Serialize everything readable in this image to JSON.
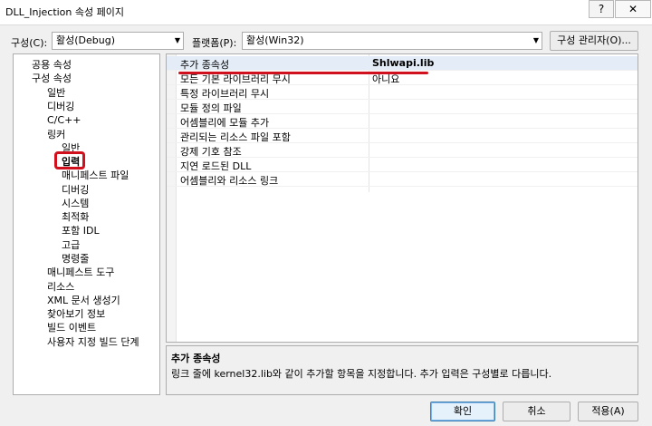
{
  "window": {
    "title": "DLL_Injection 속성 페이지",
    "help_label": "?",
    "close_label": "✕"
  },
  "toolbar": {
    "config_label": "구성(C):",
    "config_value": "활성(Debug)",
    "platform_label": "플랫폼(P):",
    "platform_value": "활성(Win32)",
    "config_manager_label": "구성 관리자(O)..."
  },
  "tree": {
    "items": [
      {
        "label": "공용 속성"
      },
      {
        "label": "구성 속성"
      },
      {
        "label": "일반"
      },
      {
        "label": "디버깅"
      },
      {
        "label": "C/C++"
      },
      {
        "label": "링커"
      },
      {
        "label": "일반"
      },
      {
        "label": "입력",
        "selected": true
      },
      {
        "label": "매니페스트 파일"
      },
      {
        "label": "디버깅"
      },
      {
        "label": "시스템"
      },
      {
        "label": "최적화"
      },
      {
        "label": "포함 IDL"
      },
      {
        "label": "고급"
      },
      {
        "label": "명령줄"
      },
      {
        "label": "매니페스트 도구"
      },
      {
        "label": "리소스"
      },
      {
        "label": "XML 문서 생성기"
      },
      {
        "label": "찾아보기 정보"
      },
      {
        "label": "빌드 이벤트"
      },
      {
        "label": "사용자 지정 빌드 단계"
      }
    ]
  },
  "properties": {
    "rows": [
      {
        "name": "추가 종속성",
        "value": "Shlwapi.lib"
      },
      {
        "name": "모든 기본 라이브러리 무시",
        "value": "아니요"
      },
      {
        "name": "특정 라이브러리 무시",
        "value": ""
      },
      {
        "name": "모듈 정의 파일",
        "value": ""
      },
      {
        "name": "어셈블리에 모듈 추가",
        "value": ""
      },
      {
        "name": "관리되는 리소스 파일 포함",
        "value": ""
      },
      {
        "name": "강제 기호 참조",
        "value": ""
      },
      {
        "name": "지연 로드된 DLL",
        "value": ""
      },
      {
        "name": "어셈블리와 리소스 링크",
        "value": ""
      }
    ]
  },
  "description": {
    "title": "추가 종속성",
    "text": "링크 줄에 kernel32.lib와 같이 추가할 항목을 지정합니다. 추가 입력은 구성별로 다릅니다."
  },
  "buttons": {
    "ok": "확인",
    "cancel": "취소",
    "apply": "적용(A)"
  },
  "colors": {
    "annotation_red": "#d0111d",
    "selected_row": "#e3ecf7"
  }
}
